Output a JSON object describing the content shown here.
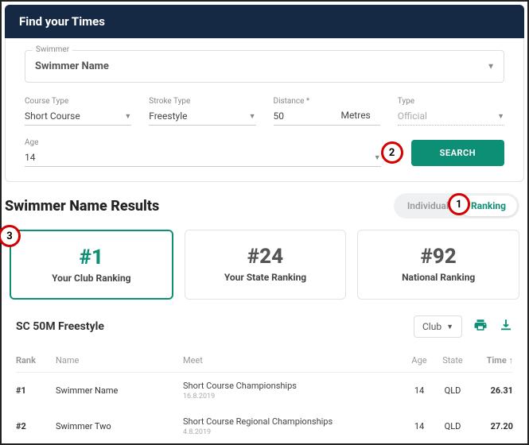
{
  "header": {
    "title": "Find your Times"
  },
  "swimmer": {
    "label": "Swimmer",
    "value": "Swimmer Name"
  },
  "filters": {
    "courseType": {
      "label": "Course Type",
      "value": "Short Course"
    },
    "strokeType": {
      "label": "Stroke Type",
      "value": "Freestyle"
    },
    "distance": {
      "label": "Distance *",
      "value": "50",
      "unit": "Metres"
    },
    "type": {
      "label": "Type",
      "value": "Official"
    },
    "age": {
      "label": "Age",
      "value": "14"
    }
  },
  "callouts": {
    "one": "1",
    "two": "2",
    "three": "3"
  },
  "searchBtn": "SEARCH",
  "results": {
    "title": "Swimmer Name Results",
    "toggle": {
      "individual": "Individual",
      "ranking": "Ranking"
    },
    "cards": [
      {
        "num": "#1",
        "label": "Your Club Ranking"
      },
      {
        "num": "#24",
        "label": "Your State Ranking"
      },
      {
        "num": "#92",
        "label": "National Ranking"
      }
    ]
  },
  "table": {
    "title": "SC 50M Freestyle",
    "scopeSel": "Club",
    "cols": {
      "rank": "Rank",
      "name": "Name",
      "meet": "Meet",
      "age": "Age",
      "state": "State",
      "time": "Time ↑"
    },
    "rows": [
      {
        "rank": "#1",
        "name": "Swimmer Name",
        "meet": "Short Course Championships",
        "date": "16.8.2019",
        "age": "14",
        "state": "QLD",
        "time": "26.31"
      },
      {
        "rank": "#2",
        "name": "Swimmer Two",
        "meet": "Short Course Regional Championships",
        "date": "4.8.2019",
        "age": "14",
        "state": "QLD",
        "time": "27.20"
      }
    ]
  }
}
